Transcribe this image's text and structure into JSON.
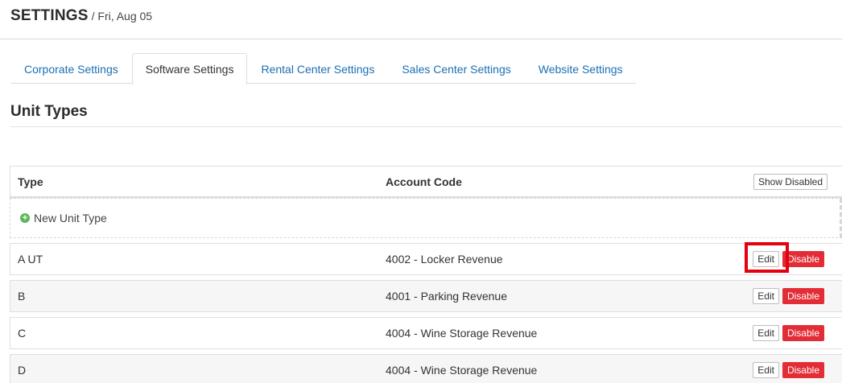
{
  "header": {
    "title": "SETTINGS",
    "subtitle": "/ Fri, Aug 05"
  },
  "tabs": [
    {
      "label": "Corporate Settings"
    },
    {
      "label": "Software Settings"
    },
    {
      "label": "Rental Center Settings"
    },
    {
      "label": "Sales Center Settings"
    },
    {
      "label": "Website Settings"
    }
  ],
  "active_tab": "Software Settings",
  "section": {
    "title": "Unit Types"
  },
  "table": {
    "columns": {
      "type": "Type",
      "account_code": "Account Code"
    },
    "show_disabled_label": "Show Disabled",
    "new_label": "New Unit Type",
    "edit_label": "Edit",
    "disable_label": "Disable",
    "rows": [
      {
        "type": "A UT",
        "account_code": "4002 - Locker Revenue"
      },
      {
        "type": "B",
        "account_code": "4001 - Parking Revenue"
      },
      {
        "type": "C",
        "account_code": "4004 - Wine Storage Revenue"
      },
      {
        "type": "D",
        "account_code": "4004 - Wine Storage Revenue"
      }
    ]
  },
  "colors": {
    "link": "#1a6fb3",
    "danger": "#e32d36",
    "success": "#5cb85c",
    "highlight": "#e3000f"
  }
}
